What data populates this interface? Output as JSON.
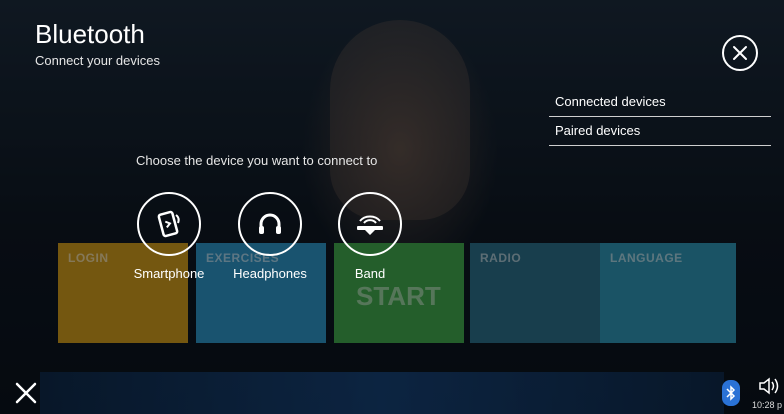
{
  "header": {
    "title": "Bluetooth",
    "subtitle": "Connect your devices"
  },
  "menu": {
    "items": [
      {
        "label": "Connected devices"
      },
      {
        "label": "Paired devices"
      }
    ]
  },
  "prompt": "Choose the device you want to connect to",
  "devices": [
    {
      "label": "Smartphone",
      "icon": "smartphone-icon"
    },
    {
      "label": "Headphones",
      "icon": "headphones-icon"
    },
    {
      "label": "Band",
      "icon": "band-icon"
    }
  ],
  "background_tiles": [
    {
      "label": "LOGIN",
      "color": "#c8961c"
    },
    {
      "label": "EXERCISES",
      "color": "#2b8fc0"
    },
    {
      "label": "START",
      "color": "#3ea34a"
    },
    {
      "label": "RADIO",
      "color": "#2a6b86"
    },
    {
      "label": "LANGUAGE",
      "color": "#2e8fae"
    }
  ],
  "status_bar": {
    "time": "10:28 p"
  },
  "colors": {
    "accent": "#ffffff",
    "bluetooth": "#2a72d6"
  }
}
